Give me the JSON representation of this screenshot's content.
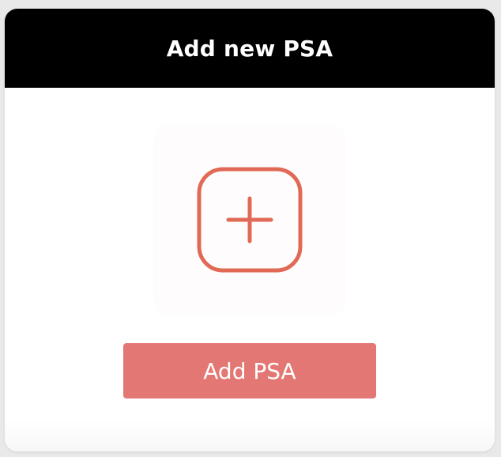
{
  "card": {
    "title": "Add new PSA"
  },
  "tile": {
    "icon": "plus-square-icon"
  },
  "actions": {
    "add_label": "Add PSA"
  },
  "colors": {
    "header_bg": "#000000",
    "accent": "#e06a55",
    "button_bg": "#e37773",
    "text_on_dark": "#ffffff"
  }
}
